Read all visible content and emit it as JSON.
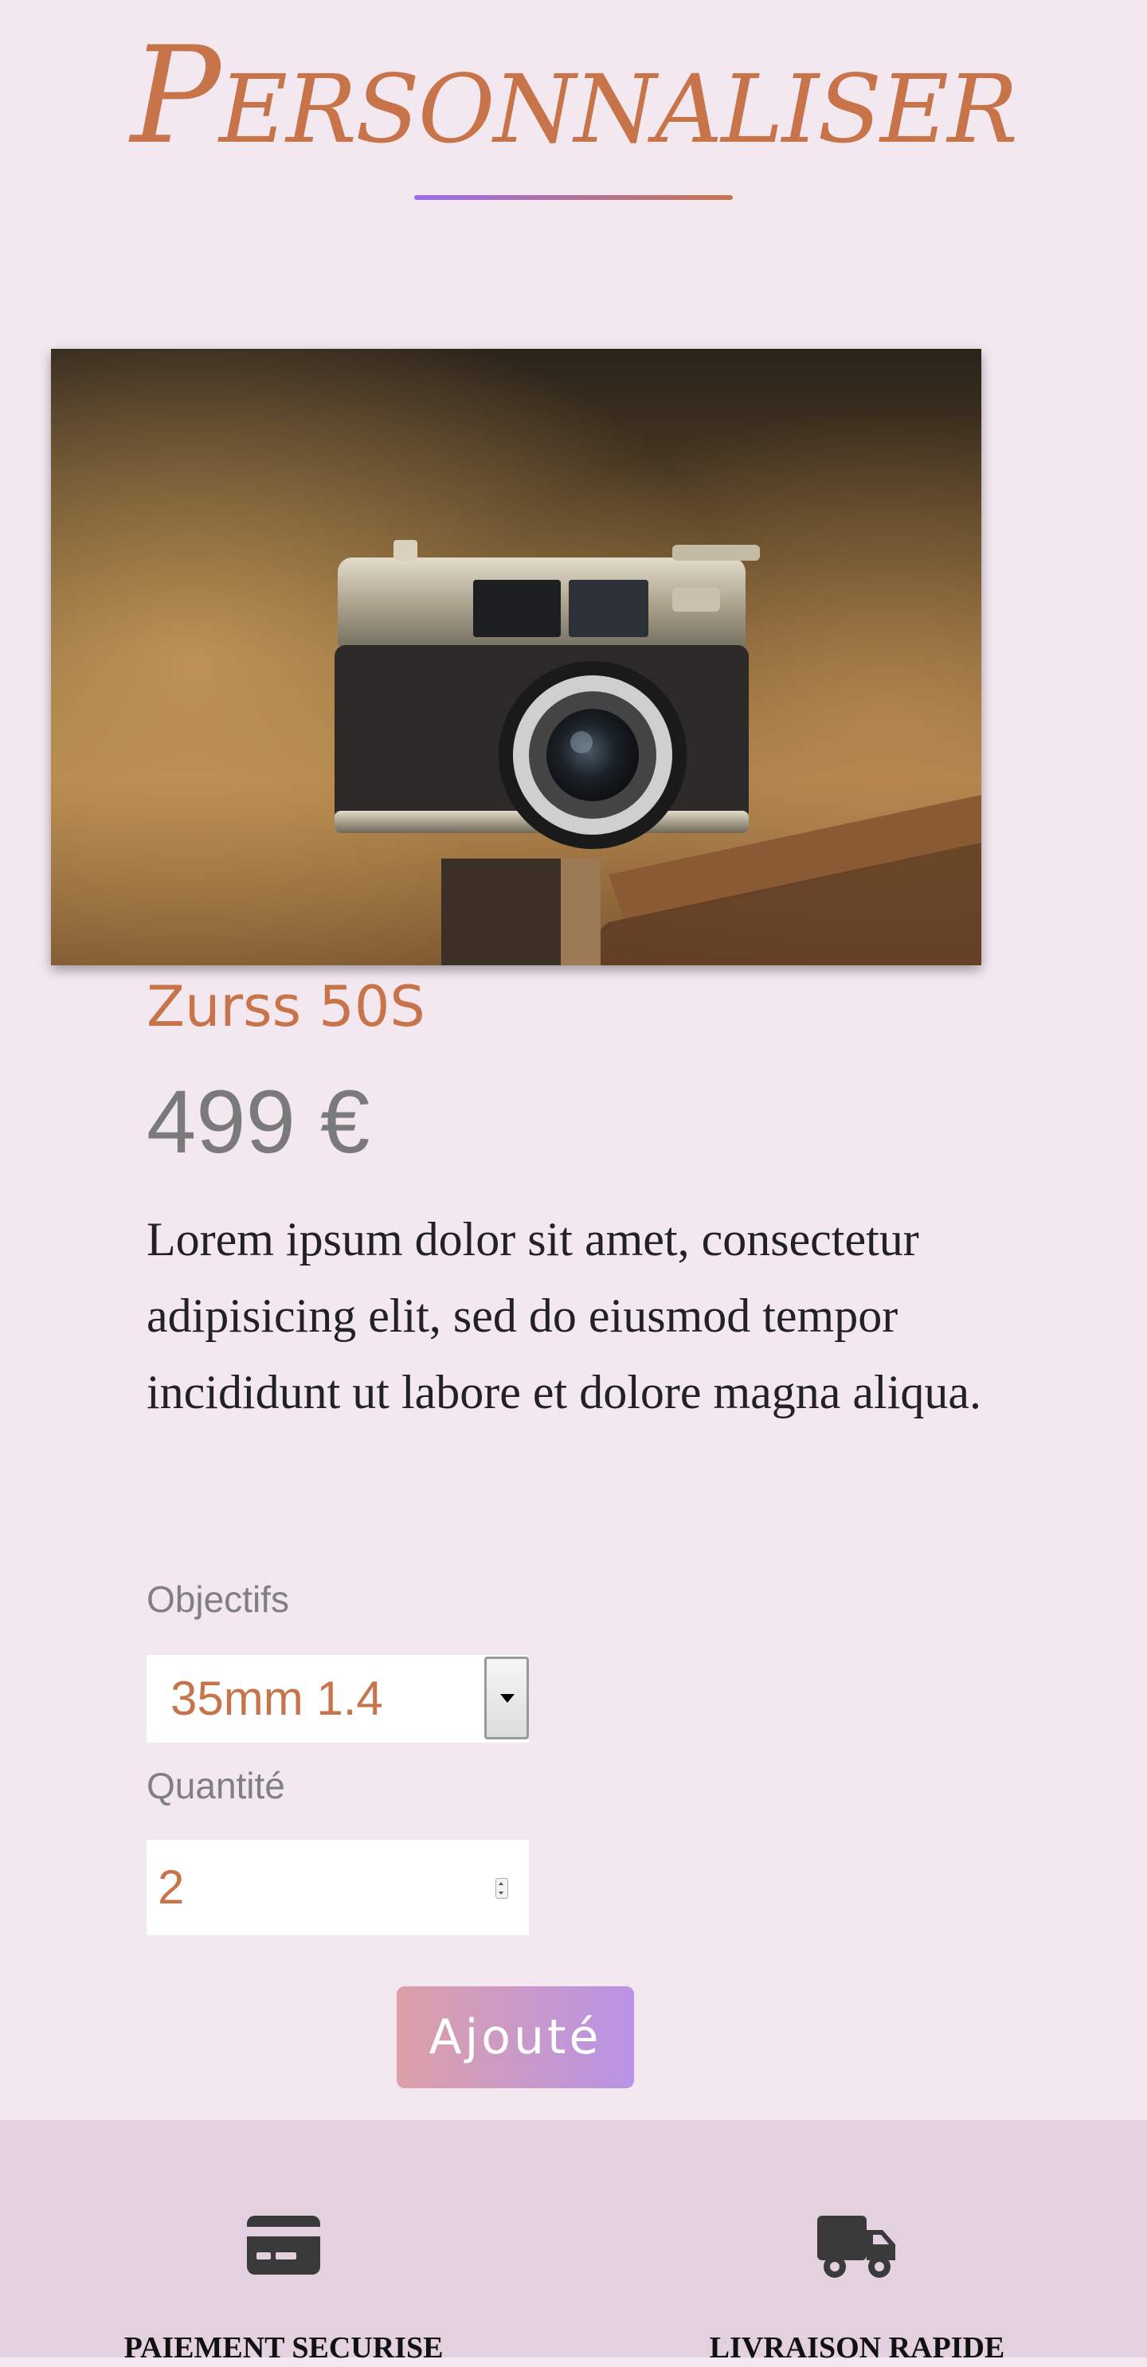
{
  "header": {
    "title": "Personnaliser",
    "underline_gradient": [
      "#9b6cf0",
      "#c8744a"
    ]
  },
  "product": {
    "image_alt": "Appareil photo argentique sur un poteau",
    "name": "Zurss 50S",
    "price": "499 €",
    "description": "Lorem ipsum dolor sit amet, consectetur adipisicing elit, sed do eiusmod tempor incididunt ut labore et dolore magna aliqua."
  },
  "form": {
    "lens_label": "Objectifs",
    "lens_selected": "35mm 1.4",
    "quantity_label": "Quantité",
    "quantity_value": "2",
    "add_button_label": "Ajouté"
  },
  "footer": {
    "features": [
      {
        "icon": "credit-card-icon",
        "label": "PAIEMENT SECURISE"
      },
      {
        "icon": "truck-icon",
        "label": "LIVRAISON RAPIDE"
      }
    ]
  },
  "colors": {
    "background": "#f3e8f0",
    "accent": "#c8744a",
    "footer_background": "#e3d1e0",
    "button_gradient": [
      "#dda0a8",
      "#b893e6"
    ]
  }
}
